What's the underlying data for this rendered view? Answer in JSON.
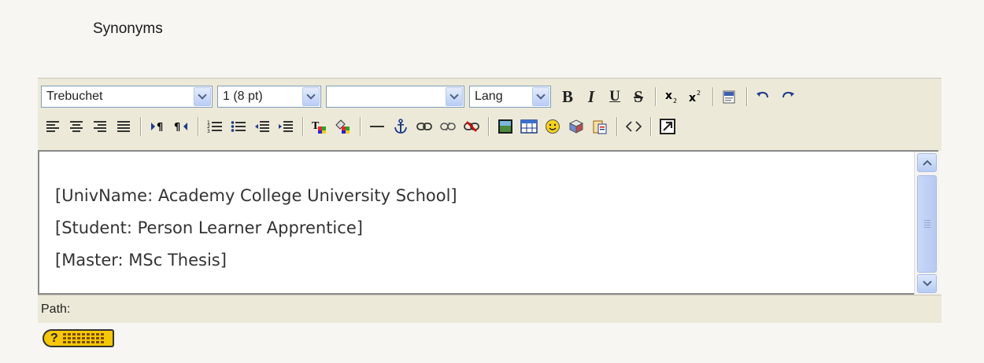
{
  "section": {
    "title": "Synonyms"
  },
  "toolbar": {
    "font_family": "Trebuchet",
    "font_size": "1 (8 pt)",
    "heading": "",
    "lang": "Lang",
    "bold": "B",
    "italic": "I",
    "underline": "U",
    "strikethrough": "S"
  },
  "content": {
    "lines": [
      "[UnivName: Academy College University School]",
      "[Student: Person Learner Apprentice]",
      "[Master: MSc Thesis]"
    ]
  },
  "status": {
    "path_label": "Path:"
  }
}
